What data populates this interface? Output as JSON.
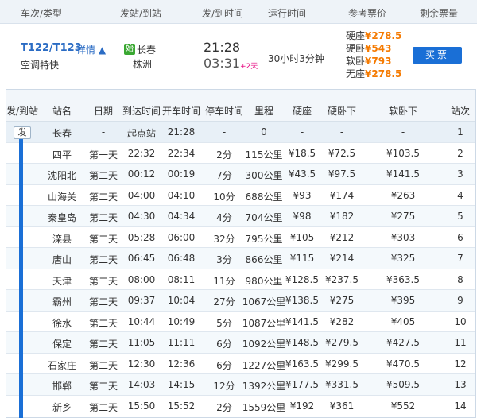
{
  "header": {
    "train_type": "车次/类型",
    "from_to": "发站/到站",
    "dep_arr_time": "发/到时间",
    "run_time": "运行时间",
    "fare": "参考票价",
    "remaining": "剩余票量"
  },
  "train": {
    "number": "T122/T123",
    "detail_label": "详情 ▲",
    "type": "空调特快",
    "start_badge": "始",
    "from_station": "长春",
    "to_station": "株洲",
    "dep_time": "21:28",
    "arr_time": "03:31",
    "plus_days": "+2天",
    "duration": "30小时3分钟",
    "fares": [
      {
        "label": "硬座",
        "price": "¥278.5"
      },
      {
        "label": "硬卧",
        "price": "¥543"
      },
      {
        "label": "软卧",
        "price": "¥793"
      },
      {
        "label": "无座",
        "price": "¥278.5"
      }
    ],
    "buy_label": "买票"
  },
  "stops_header": {
    "dep_arr": "发/到站",
    "station": "站名",
    "date": "日期",
    "arr_time": "到达时间",
    "dep_time": "开车时间",
    "stop_time": "停车时间",
    "distance": "里程",
    "hard_seat": "硬座",
    "hard_sleeper": "硬卧下",
    "soft_sleeper": "软卧下",
    "order": "站次"
  },
  "start_badge": "发",
  "stops": [
    {
      "station": "长春",
      "date": "-",
      "arr": "起点站",
      "dep": "21:28",
      "stop": "-",
      "dist": "0",
      "hs": "-",
      "hsl": "-",
      "ssl": "-",
      "no": "1"
    },
    {
      "station": "四平",
      "date": "第一天",
      "arr": "22:32",
      "dep": "22:34",
      "stop": "2分",
      "dist": "115公里",
      "hs": "¥18.5",
      "hsl": "¥72.5",
      "ssl": "¥103.5",
      "no": "2"
    },
    {
      "station": "沈阳北",
      "date": "第二天",
      "arr": "00:12",
      "dep": "00:19",
      "stop": "7分",
      "dist": "300公里",
      "hs": "¥43.5",
      "hsl": "¥97.5",
      "ssl": "¥141.5",
      "no": "3"
    },
    {
      "station": "山海关",
      "date": "第二天",
      "arr": "04:00",
      "dep": "04:10",
      "stop": "10分",
      "dist": "688公里",
      "hs": "¥93",
      "hsl": "¥174",
      "ssl": "¥263",
      "no": "4"
    },
    {
      "station": "秦皇岛",
      "date": "第二天",
      "arr": "04:30",
      "dep": "04:34",
      "stop": "4分",
      "dist": "704公里",
      "hs": "¥98",
      "hsl": "¥182",
      "ssl": "¥275",
      "no": "5"
    },
    {
      "station": "滦县",
      "date": "第二天",
      "arr": "05:28",
      "dep": "06:00",
      "stop": "32分",
      "dist": "795公里",
      "hs": "¥105",
      "hsl": "¥212",
      "ssl": "¥303",
      "no": "6"
    },
    {
      "station": "唐山",
      "date": "第二天",
      "arr": "06:45",
      "dep": "06:48",
      "stop": "3分",
      "dist": "866公里",
      "hs": "¥115",
      "hsl": "¥214",
      "ssl": "¥325",
      "no": "7"
    },
    {
      "station": "天津",
      "date": "第二天",
      "arr": "08:00",
      "dep": "08:11",
      "stop": "11分",
      "dist": "980公里",
      "hs": "¥128.5",
      "hsl": "¥237.5",
      "ssl": "¥363.5",
      "no": "8"
    },
    {
      "station": "霸州",
      "date": "第二天",
      "arr": "09:37",
      "dep": "10:04",
      "stop": "27分",
      "dist": "1067公里",
      "hs": "¥138.5",
      "hsl": "¥275",
      "ssl": "¥395",
      "no": "9"
    },
    {
      "station": "徐水",
      "date": "第二天",
      "arr": "10:44",
      "dep": "10:49",
      "stop": "5分",
      "dist": "1087公里",
      "hs": "¥141.5",
      "hsl": "¥282",
      "ssl": "¥405",
      "no": "10"
    },
    {
      "station": "保定",
      "date": "第二天",
      "arr": "11:05",
      "dep": "11:11",
      "stop": "6分",
      "dist": "1092公里",
      "hs": "¥148.5",
      "hsl": "¥279.5",
      "ssl": "¥427.5",
      "no": "11"
    },
    {
      "station": "石家庄",
      "date": "第二天",
      "arr": "12:30",
      "dep": "12:36",
      "stop": "6分",
      "dist": "1227公里",
      "hs": "¥163.5",
      "hsl": "¥299.5",
      "ssl": "¥470.5",
      "no": "12"
    },
    {
      "station": "邯郸",
      "date": "第二天",
      "arr": "14:03",
      "dep": "14:15",
      "stop": "12分",
      "dist": "1392公里",
      "hs": "¥177.5",
      "hsl": "¥331.5",
      "ssl": "¥509.5",
      "no": "13"
    },
    {
      "station": "新乡",
      "date": "第二天",
      "arr": "15:50",
      "dep": "15:52",
      "stop": "2分",
      "dist": "1559公里",
      "hs": "¥192",
      "hsl": "¥361",
      "ssl": "¥552",
      "no": "14"
    }
  ]
}
